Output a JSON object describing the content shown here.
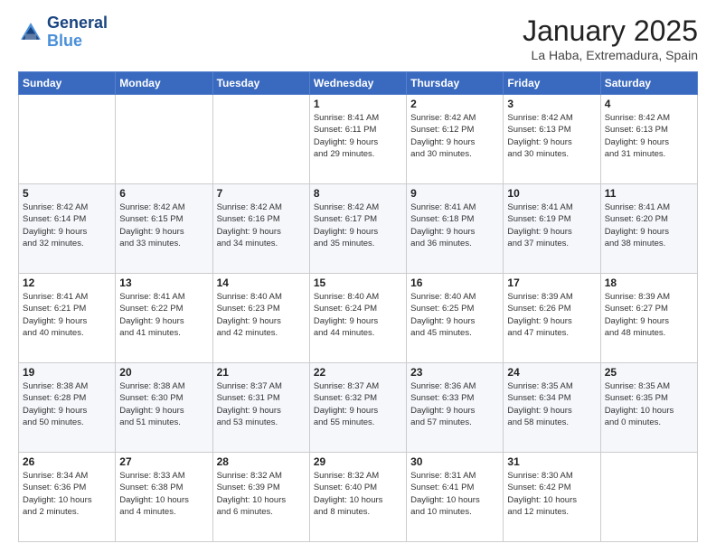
{
  "header": {
    "logo_line1": "General",
    "logo_line2": "Blue",
    "month_title": "January 2025",
    "location": "La Haba, Extremadura, Spain"
  },
  "days_of_week": [
    "Sunday",
    "Monday",
    "Tuesday",
    "Wednesday",
    "Thursday",
    "Friday",
    "Saturday"
  ],
  "weeks": [
    [
      {
        "day": "",
        "info": ""
      },
      {
        "day": "",
        "info": ""
      },
      {
        "day": "",
        "info": ""
      },
      {
        "day": "1",
        "info": "Sunrise: 8:41 AM\nSunset: 6:11 PM\nDaylight: 9 hours\nand 29 minutes."
      },
      {
        "day": "2",
        "info": "Sunrise: 8:42 AM\nSunset: 6:12 PM\nDaylight: 9 hours\nand 30 minutes."
      },
      {
        "day": "3",
        "info": "Sunrise: 8:42 AM\nSunset: 6:13 PM\nDaylight: 9 hours\nand 30 minutes."
      },
      {
        "day": "4",
        "info": "Sunrise: 8:42 AM\nSunset: 6:13 PM\nDaylight: 9 hours\nand 31 minutes."
      }
    ],
    [
      {
        "day": "5",
        "info": "Sunrise: 8:42 AM\nSunset: 6:14 PM\nDaylight: 9 hours\nand 32 minutes."
      },
      {
        "day": "6",
        "info": "Sunrise: 8:42 AM\nSunset: 6:15 PM\nDaylight: 9 hours\nand 33 minutes."
      },
      {
        "day": "7",
        "info": "Sunrise: 8:42 AM\nSunset: 6:16 PM\nDaylight: 9 hours\nand 34 minutes."
      },
      {
        "day": "8",
        "info": "Sunrise: 8:42 AM\nSunset: 6:17 PM\nDaylight: 9 hours\nand 35 minutes."
      },
      {
        "day": "9",
        "info": "Sunrise: 8:41 AM\nSunset: 6:18 PM\nDaylight: 9 hours\nand 36 minutes."
      },
      {
        "day": "10",
        "info": "Sunrise: 8:41 AM\nSunset: 6:19 PM\nDaylight: 9 hours\nand 37 minutes."
      },
      {
        "day": "11",
        "info": "Sunrise: 8:41 AM\nSunset: 6:20 PM\nDaylight: 9 hours\nand 38 minutes."
      }
    ],
    [
      {
        "day": "12",
        "info": "Sunrise: 8:41 AM\nSunset: 6:21 PM\nDaylight: 9 hours\nand 40 minutes."
      },
      {
        "day": "13",
        "info": "Sunrise: 8:41 AM\nSunset: 6:22 PM\nDaylight: 9 hours\nand 41 minutes."
      },
      {
        "day": "14",
        "info": "Sunrise: 8:40 AM\nSunset: 6:23 PM\nDaylight: 9 hours\nand 42 minutes."
      },
      {
        "day": "15",
        "info": "Sunrise: 8:40 AM\nSunset: 6:24 PM\nDaylight: 9 hours\nand 44 minutes."
      },
      {
        "day": "16",
        "info": "Sunrise: 8:40 AM\nSunset: 6:25 PM\nDaylight: 9 hours\nand 45 minutes."
      },
      {
        "day": "17",
        "info": "Sunrise: 8:39 AM\nSunset: 6:26 PM\nDaylight: 9 hours\nand 47 minutes."
      },
      {
        "day": "18",
        "info": "Sunrise: 8:39 AM\nSunset: 6:27 PM\nDaylight: 9 hours\nand 48 minutes."
      }
    ],
    [
      {
        "day": "19",
        "info": "Sunrise: 8:38 AM\nSunset: 6:28 PM\nDaylight: 9 hours\nand 50 minutes."
      },
      {
        "day": "20",
        "info": "Sunrise: 8:38 AM\nSunset: 6:30 PM\nDaylight: 9 hours\nand 51 minutes."
      },
      {
        "day": "21",
        "info": "Sunrise: 8:37 AM\nSunset: 6:31 PM\nDaylight: 9 hours\nand 53 minutes."
      },
      {
        "day": "22",
        "info": "Sunrise: 8:37 AM\nSunset: 6:32 PM\nDaylight: 9 hours\nand 55 minutes."
      },
      {
        "day": "23",
        "info": "Sunrise: 8:36 AM\nSunset: 6:33 PM\nDaylight: 9 hours\nand 57 minutes."
      },
      {
        "day": "24",
        "info": "Sunrise: 8:35 AM\nSunset: 6:34 PM\nDaylight: 9 hours\nand 58 minutes."
      },
      {
        "day": "25",
        "info": "Sunrise: 8:35 AM\nSunset: 6:35 PM\nDaylight: 10 hours\nand 0 minutes."
      }
    ],
    [
      {
        "day": "26",
        "info": "Sunrise: 8:34 AM\nSunset: 6:36 PM\nDaylight: 10 hours\nand 2 minutes."
      },
      {
        "day": "27",
        "info": "Sunrise: 8:33 AM\nSunset: 6:38 PM\nDaylight: 10 hours\nand 4 minutes."
      },
      {
        "day": "28",
        "info": "Sunrise: 8:32 AM\nSunset: 6:39 PM\nDaylight: 10 hours\nand 6 minutes."
      },
      {
        "day": "29",
        "info": "Sunrise: 8:32 AM\nSunset: 6:40 PM\nDaylight: 10 hours\nand 8 minutes."
      },
      {
        "day": "30",
        "info": "Sunrise: 8:31 AM\nSunset: 6:41 PM\nDaylight: 10 hours\nand 10 minutes."
      },
      {
        "day": "31",
        "info": "Sunrise: 8:30 AM\nSunset: 6:42 PM\nDaylight: 10 hours\nand 12 minutes."
      },
      {
        "day": "",
        "info": ""
      }
    ]
  ]
}
